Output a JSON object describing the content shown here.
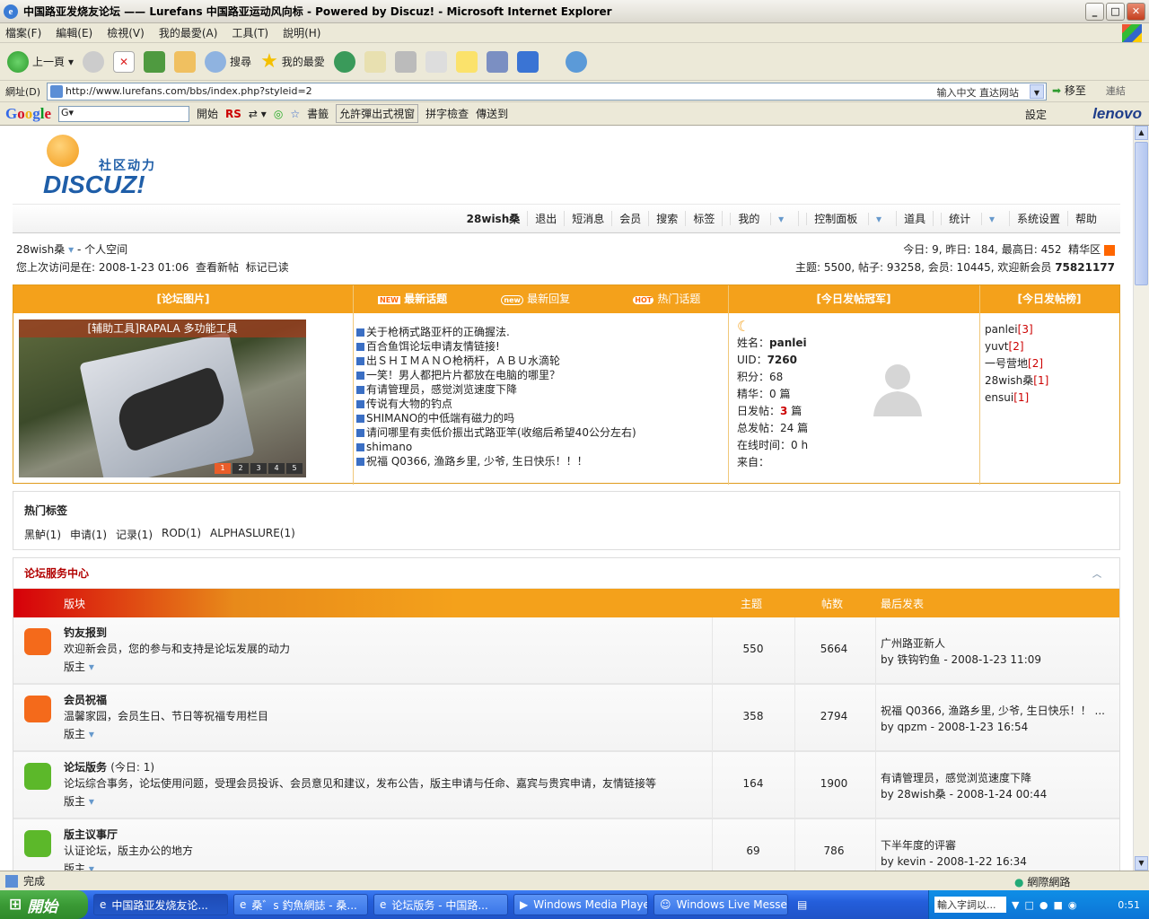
{
  "window": {
    "title": "中国路亚发烧友论坛 —— Lurefans 中国路亚运动风向标 - Powered by Discuz! - Microsoft Internet Explorer"
  },
  "menu": [
    "檔案(F)",
    "編輯(E)",
    "檢視(V)",
    "我的最愛(A)",
    "工具(T)",
    "說明(H)"
  ],
  "toolbar": {
    "back": "上一頁",
    "search": "搜尋",
    "favorites": "我的最愛"
  },
  "address": {
    "label": "網址(D)",
    "url": "http://www.lurefans.com/bbs/index.php?styleid=2",
    "hint": "输入中文 直达网站",
    "go": "移至",
    "links": "連結"
  },
  "googlebar": {
    "logo": "Google",
    "g": "G",
    "start": "開始",
    "rs": "RS",
    "bookmarks": "書籤",
    "popup": "允許彈出式視窗",
    "spell": "拼字檢查",
    "sendto": "傳送到",
    "settings": "設定",
    "brand": "lenovo"
  },
  "logo": {
    "sub": "社区动力",
    "main": "DISCUZ!"
  },
  "nav": {
    "user": "28wish桑",
    "items": [
      "退出",
      "短消息",
      "会员",
      "搜索",
      "标签",
      "我的",
      "控制面板",
      "道具",
      "统计",
      "系统设置",
      "帮助"
    ]
  },
  "info": {
    "user": "28wish桑",
    "space": "- 个人空间",
    "lastvisit": "您上次访问是在: 2008-1-23 01:06",
    "newposts": "查看新帖",
    "markread": "标记已读",
    "today": "今日: 9, 昨日: 184, 最高日: 452",
    "digest": "精华区",
    "stats": "主题: 5500, 帖子: 93258, 会员: 10445, 欢迎新会员",
    "newmember": "75821177"
  },
  "panel": {
    "h_photos": "[论坛图片]",
    "h_new_topics": "最新话题",
    "h_new_replies": "最新回复",
    "h_hot": "热门话题",
    "h_champion": "[今日发帖冠军]",
    "h_rank": "[今日发帖榜]",
    "photo_caption": "[辅助工具]RAPALA 多功能工具",
    "pages": [
      "1",
      "2",
      "3",
      "4",
      "5"
    ],
    "topics": [
      "关于枪柄式路亚杆的正确握法.",
      "百合鱼饵论坛申请友情链接!",
      "出ＳＨＩＭＡＮＯ枪柄杆，ＡＢＵ水滴轮",
      "一笑！男人都把片片都放在电脑的哪里？",
      "有请管理员，感觉浏览速度下降",
      "传说有大物的钓点",
      "SHIMANO的中低端有磁力的吗",
      "请问哪里有卖低价振出式路亚竿(收缩后希望40公分左右)",
      "shimano",
      "祝福 Q0366, 渔路乡里, 少爷, 生日快乐！！！"
    ],
    "champion": {
      "name_label": "姓名：",
      "name": "panlei",
      "uid_label": "UID：",
      "uid": "7260",
      "credits": "积分：68",
      "digest": "精华：0 篇",
      "today_label": "日发帖：",
      "today_count": "3",
      "today_unit": " 篇",
      "total": "总发帖：24 篇",
      "online": "在线时间：0 h",
      "from": "来自："
    },
    "rank": [
      {
        "name": "panlei",
        "count": "[3]"
      },
      {
        "name": "yuvt",
        "count": "[2]"
      },
      {
        "name": "一号营地",
        "count": "[2]"
      },
      {
        "name": "28wish桑",
        "count": "[1]"
      },
      {
        "name": "ensui",
        "count": "[1]"
      }
    ]
  },
  "tags": {
    "title": "热门标签",
    "items": [
      "黑鲈(1)",
      "申请(1)",
      "记录(1)",
      "ROD(1)",
      "ALPHASLURE(1)"
    ]
  },
  "forum": {
    "section": "论坛服务中心",
    "cols": {
      "name": "版块",
      "topics": "主题",
      "posts": "帖数",
      "last": "最后发表"
    },
    "rows": [
      {
        "name": "钓友报到",
        "today": "",
        "desc": "欢迎新会员，您的参与和支持是论坛发展的动力",
        "mod": "版主",
        "topics": "550",
        "posts": "5664",
        "last_title": "广州路亚新人",
        "last_by": "by 铁钩钓鱼",
        "last_time": " - 2008-1-23 11:09",
        "color": "#f46a1b"
      },
      {
        "name": "会员祝福",
        "today": "",
        "desc": "温馨家园，会员生日、节日等祝福专用栏目",
        "mod": "版主",
        "topics": "358",
        "posts": "2794",
        "last_title": "祝福  Q0366, 渔路乡里, 少爷, 生日快乐！！ ...",
        "last_by": "by qpzm",
        "last_time": " - 2008-1-23 16:54",
        "color": "#f46a1b"
      },
      {
        "name": "论坛版务",
        "today": "(今日: 1)",
        "desc": "论坛综合事务，论坛使用问题，受理会员投诉、会员意见和建议，发布公告，版主申请与任命、嘉宾与贵宾申请，友情链接等",
        "mod": "版主",
        "topics": "164",
        "posts": "1900",
        "last_title": "有请管理员，感觉浏览速度下降",
        "last_by": "by 28wish桑",
        "last_time": " - 2008-1-24 00:44",
        "color": "#5cb82a"
      },
      {
        "name": "版主议事厅",
        "today": "",
        "desc": "认证论坛，版主办公的地方",
        "mod": "版主",
        "topics": "69",
        "posts": "786",
        "last_title": "下半年度的评審",
        "last_by": "by kevin",
        "last_time": " - 2008-1-22 16:34",
        "color": "#5cb82a"
      }
    ]
  },
  "status": {
    "text": "完成",
    "zone": "網際網路"
  },
  "taskbar": {
    "start": "開始",
    "tasks": [
      "中国路亚发烧友论...",
      "桑゛s 釣魚網誌 - 桑...",
      "论坛版务 - 中国路...",
      "Windows Media Player",
      "Windows Live Messe..."
    ],
    "input": "輸入字詞以...",
    "clock": "0:51"
  }
}
